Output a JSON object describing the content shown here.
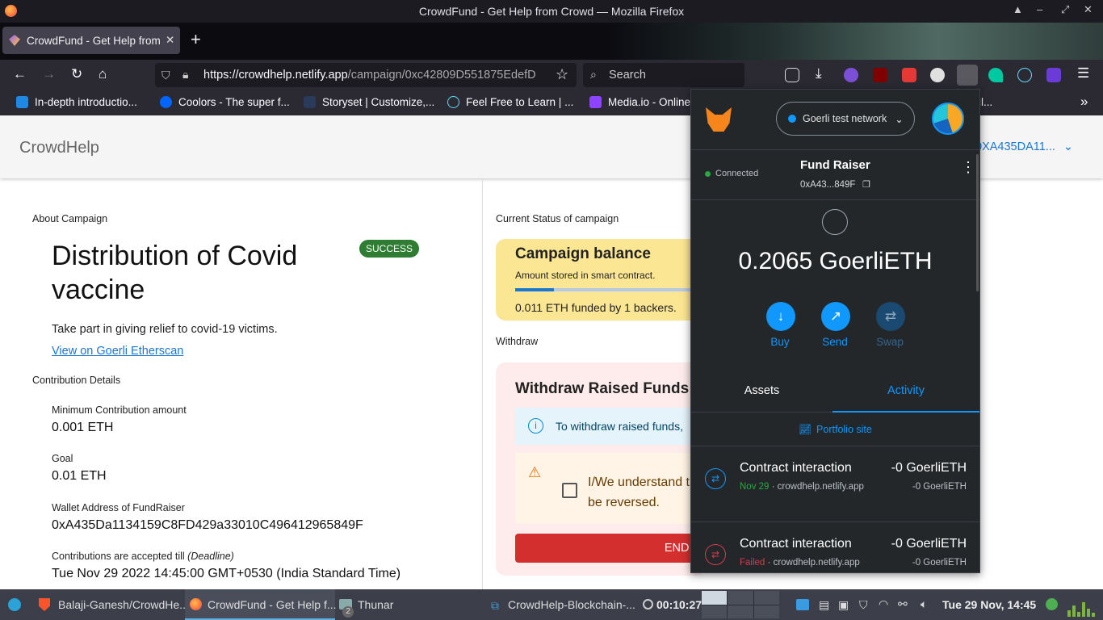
{
  "window": {
    "title": "CrowdFund - Get Help from Crowd — Mozilla Firefox"
  },
  "tabs": [
    {
      "label": "CrowdFund - Get Help from Crowd",
      "close": "✕"
    }
  ],
  "newtab": "+",
  "url": {
    "host": "https://crowdhelp.netlify.app",
    "path": "/campaign/0xc42809D551875EdefD"
  },
  "search": {
    "placeholder": "Search"
  },
  "bookmarks": [
    {
      "label": "In-depth introductio...",
      "color": "#1e88e5"
    },
    {
      "label": "Coolors - The super f...",
      "color": "#0066ff"
    },
    {
      "label": "Storyset | Customize,...",
      "color": "#2a3a5a"
    },
    {
      "label": "Feel Free to Learn | ...",
      "color": "#61dafb"
    },
    {
      "label": "Media.io - Online...",
      "color": "#8e44ff"
    },
    {
      "label": "ogl...",
      "color": "#4285f4"
    }
  ],
  "app": {
    "brand": "CrowdHelp",
    "account": "0XA435DA11...",
    "about_label": "About Campaign",
    "title": "Distribution of Covid vaccine",
    "status": "SUCCESS",
    "description": "Take part in giving relief to covid-19 victims.",
    "etherscan_link": "View on Goerli Etherscan",
    "contribution_label": "Contribution Details",
    "details": [
      {
        "key": "Minimum Contribution amount",
        "value": "0.001 ETH"
      },
      {
        "key": "Goal",
        "value": "0.01 ETH"
      },
      {
        "key": "Wallet Address of FundRaiser",
        "value": "0xA435Da1134159C8FD429a33010C496412965849F"
      }
    ],
    "deadline_key": "Contributions are accepted till",
    "deadline_key_em": "(Deadline)",
    "deadline_value": "Tue Nov 29 2022 14:45:00 GMT+0530 (India Standard Time)",
    "current_status_label": "Current Status of campaign",
    "balance_title": "Campaign balance",
    "balance_sub": "Amount stored in smart contract.",
    "balance_progress": 0.2,
    "funded_text": "0.011 ETH funded by 1 backers.",
    "withdraw_label": "Withdraw",
    "withdraw_title": "Withdraw Raised Funds",
    "withdraw_info": "To withdraw raised funds,",
    "withdraw_check_line1": "I/We understand t",
    "withdraw_check_line2": "be reversed.",
    "end_button": "END C"
  },
  "metamask": {
    "network": "Goerli test network",
    "connected": "Connected",
    "account_name": "Fund Raiser",
    "account_addr": "0xA43...849F",
    "balance": "0.2065 GoerliETH",
    "actions": [
      {
        "label": "Buy",
        "icon": "↓"
      },
      {
        "label": "Send",
        "icon": "↗"
      },
      {
        "label": "Swap",
        "icon": "⇄"
      }
    ],
    "tabs": [
      "Assets",
      "Activity"
    ],
    "portfolio_link": "Portfolio site",
    "transactions": [
      {
        "title": "Contract interaction",
        "amount": "-0 GoerliETH",
        "date": "Nov 29",
        "status_color": "#28a745",
        "site": "crowdhelp.netlify.app",
        "sub_amount": "-0 GoerliETH"
      },
      {
        "title": "Contract interaction",
        "amount": "-0 GoerliETH",
        "date": "Failed",
        "status_color": "#d73a49",
        "site": "crowdhelp.netlify.app",
        "sub_amount": "-0 GoerliETH"
      }
    ]
  },
  "taskbar": {
    "items": [
      "Balaji-Ganesh/CrowdHe...",
      "CrowdFund - Get Help f...",
      "Thunar",
      "CrowdHelp-Blockchain-..."
    ],
    "thunar_badge": "2",
    "timer": "00:10:27",
    "clock": "Tue 29 Nov, 14:45"
  }
}
